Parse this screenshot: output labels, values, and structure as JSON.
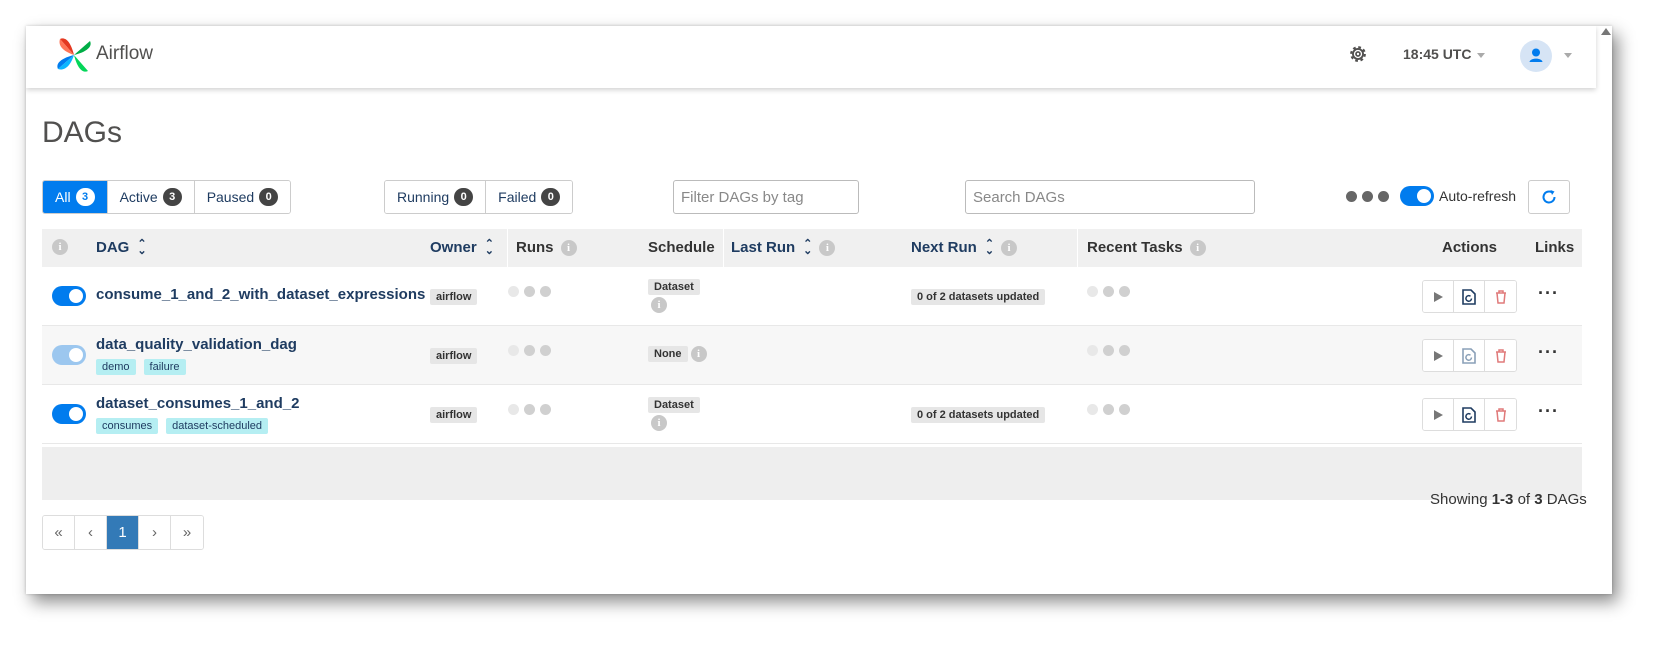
{
  "navbar": {
    "brand": "Airflow",
    "time": "18:45 UTC"
  },
  "page": {
    "title": "DAGs"
  },
  "status_filter": [
    {
      "label": "All",
      "count": "3",
      "active": true
    },
    {
      "label": "Active",
      "count": "3",
      "active": false
    },
    {
      "label": "Paused",
      "count": "0",
      "active": false
    }
  ],
  "run_filter": [
    {
      "label": "Running",
      "count": "0"
    },
    {
      "label": "Failed",
      "count": "0"
    }
  ],
  "tag_filter": {
    "placeholder": "Filter DAGs by tag"
  },
  "search": {
    "placeholder": "Search DAGs"
  },
  "auto_refresh": {
    "label": "Auto-refresh",
    "enabled": true
  },
  "table": {
    "headers": {
      "dag": "DAG",
      "owner": "Owner",
      "runs": "Runs",
      "schedule": "Schedule",
      "last_run": "Last Run",
      "next_run": "Next Run",
      "recent_tasks": "Recent Tasks",
      "actions": "Actions",
      "links": "Links"
    },
    "rows": [
      {
        "dag_id": "consume_1_and_2_with_dataset_expressions",
        "tags": [],
        "paused": false,
        "owner": "airflow",
        "schedule": "Dataset",
        "next_run": "0 of 2 datasets updated"
      },
      {
        "dag_id": "data_quality_validation_dag",
        "tags": [
          "demo",
          "failure"
        ],
        "paused": true,
        "owner": "airflow",
        "schedule": "None",
        "next_run": ""
      },
      {
        "dag_id": "dataset_consumes_1_and_2",
        "tags": [
          "consumes",
          "dataset-scheduled"
        ],
        "paused": false,
        "owner": "airflow",
        "schedule": "Dataset",
        "next_run": "0 of 2 datasets updated"
      }
    ]
  },
  "pagination": {
    "first": "«",
    "prev": "‹",
    "current": "1",
    "next": "›",
    "last": "»"
  },
  "summary": {
    "prefix": "Showing",
    "range": "1-3",
    "of": "of",
    "total": "3",
    "suffix": "DAGs"
  },
  "colors": {
    "accent": "#017cee",
    "link": "#1f3c61",
    "tag_bg": "#b5eef2",
    "delete_red": "#e07a7a"
  }
}
